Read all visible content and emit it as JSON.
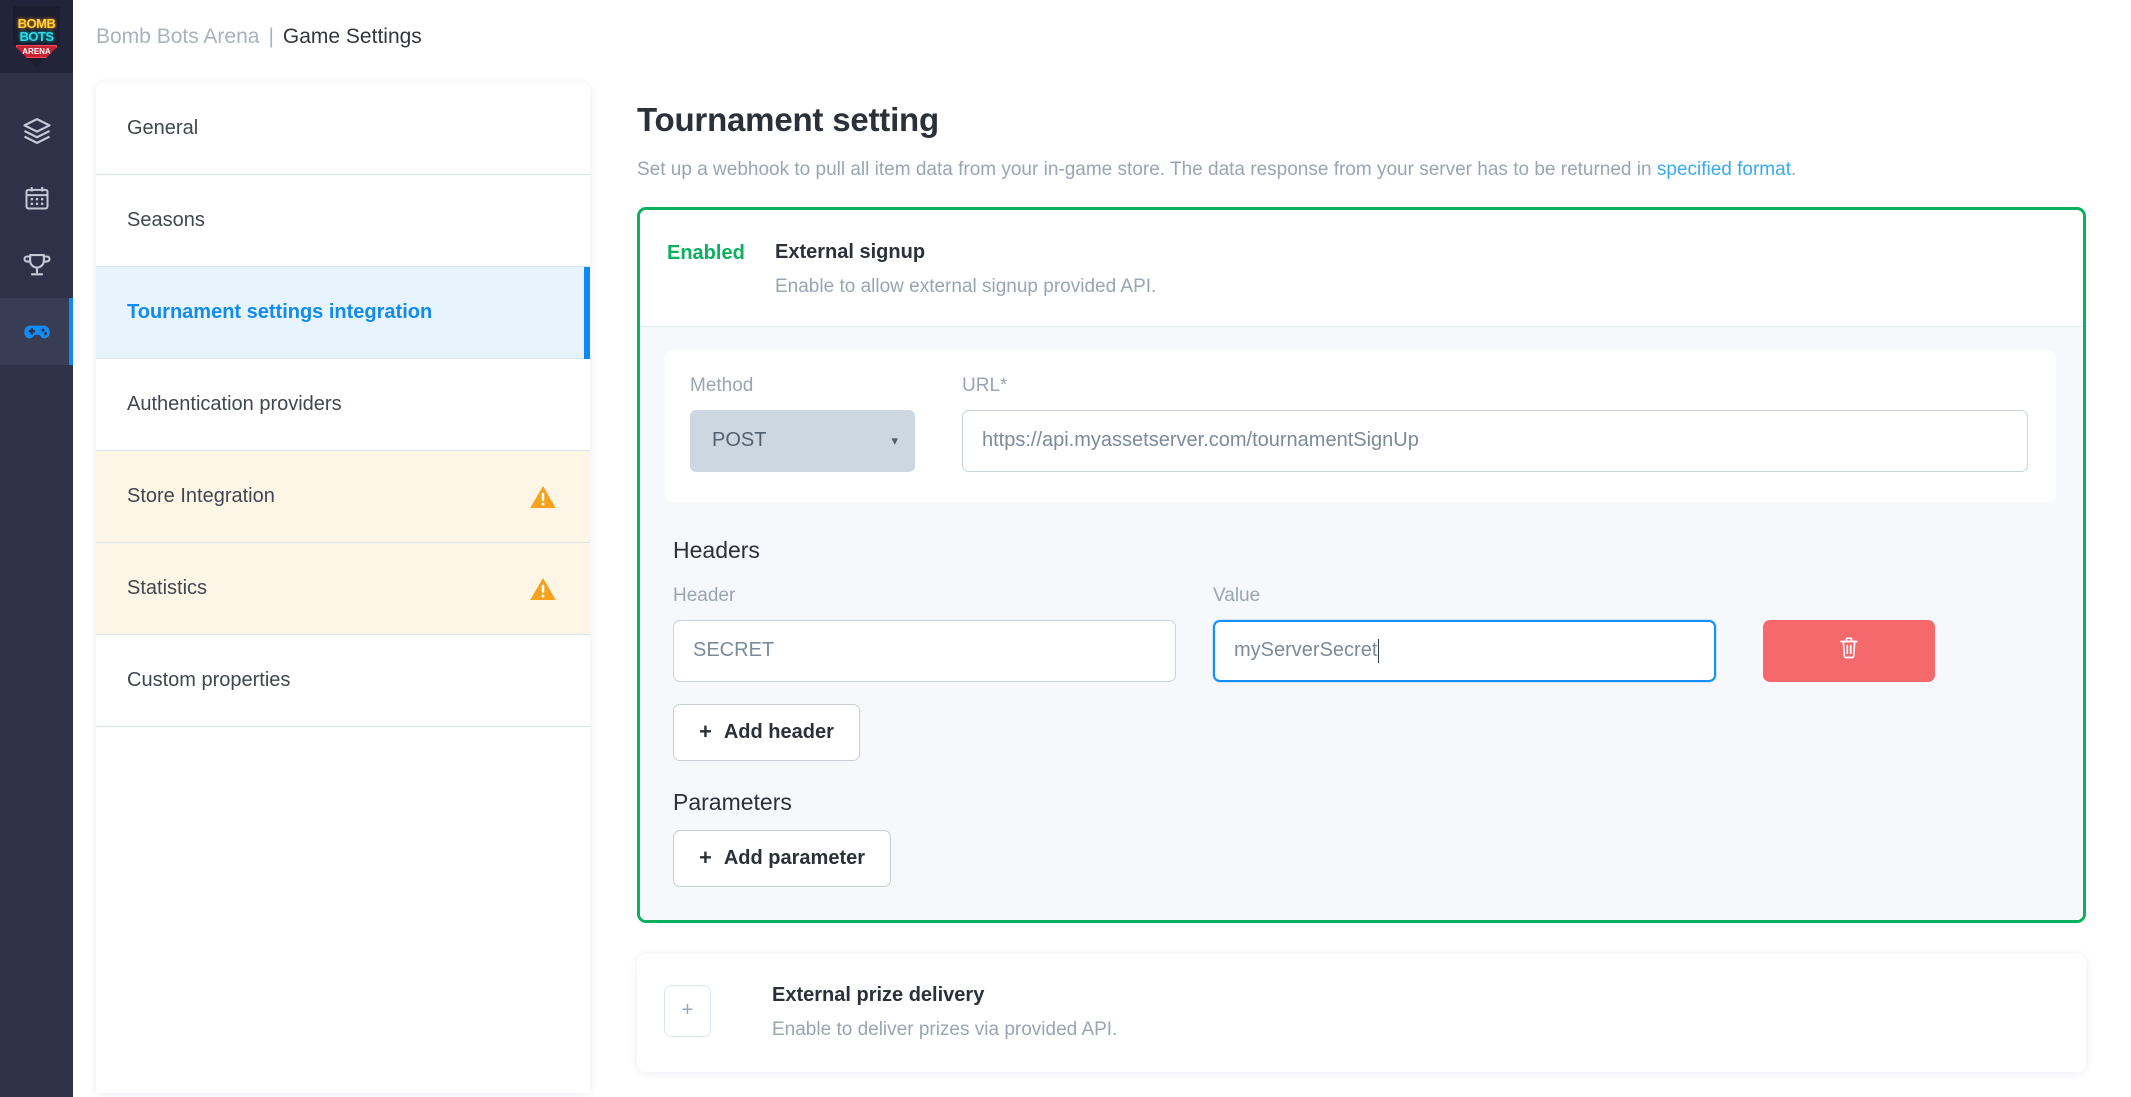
{
  "brand": {
    "logo_line1": "BOMB",
    "logo_line2": "BOTS",
    "logo_line3": "ARENA",
    "accent_blue": "#0d8bf2",
    "accent_green": "#0bb05f",
    "accent_red": "#f5686c",
    "accent_orange": "#f5a21e"
  },
  "topbar": {
    "app_name": "Bomb Bots Arena",
    "separator": "|",
    "page_name": "Game Settings"
  },
  "rail": {
    "items": [
      {
        "icon": "layers-icon",
        "active": false
      },
      {
        "icon": "calendar-icon",
        "active": false
      },
      {
        "icon": "trophy-icon",
        "active": false
      },
      {
        "icon": "gamepad-icon",
        "active": true
      }
    ]
  },
  "settings_nav": {
    "items": [
      {
        "label": "General",
        "state": "default",
        "warning": false
      },
      {
        "label": "Seasons",
        "state": "default",
        "warning": false
      },
      {
        "label": "Tournament settings integration",
        "state": "active",
        "warning": false
      },
      {
        "label": "Authentication providers",
        "state": "default",
        "warning": false
      },
      {
        "label": "Store Integration",
        "state": "warning",
        "warning": true
      },
      {
        "label": "Statistics",
        "state": "warning",
        "warning": true
      },
      {
        "label": "Custom properties",
        "state": "default",
        "warning": false
      }
    ]
  },
  "panel": {
    "title": "Tournament setting",
    "description_before": "Set up a webhook to pull all item data from your in-game store. The data response from your server has to be returned in ",
    "description_link": "specified format",
    "description_after": "."
  },
  "webhook": {
    "status_label": "Enabled",
    "title": "External signup",
    "description": "Enable to allow external signup provided API.",
    "method_label": "Method",
    "method_value": "POST",
    "method_caret": "▾",
    "url_label": "URL*",
    "url_value": "https://api.myassetserver.com/tournamentSignUp",
    "headers_section_title": "Headers",
    "header_col_label": "Header",
    "value_col_label": "Value",
    "rows": [
      {
        "header": "SECRET",
        "value": "myServerSecret",
        "value_focused": true
      }
    ],
    "add_header_label": "Add header",
    "add_header_plus": "+",
    "parameters_section_title": "Parameters",
    "add_parameter_label": "Add parameter",
    "add_parameter_plus": "+",
    "delete_icon": "trash-icon"
  },
  "collapsed_card": {
    "expand_symbol": "+",
    "title": "External prize delivery",
    "description": "Enable to deliver prizes via provided API."
  }
}
